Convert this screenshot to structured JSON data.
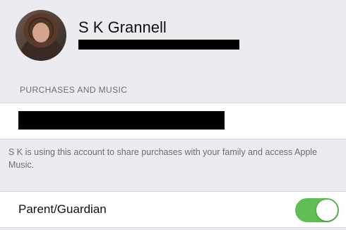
{
  "profile": {
    "name": "S K Grannell",
    "avatar": "user-avatar-photo",
    "email_redacted": true
  },
  "section": {
    "header": "PURCHASES AND MUSIC"
  },
  "account": {
    "value_redacted": true
  },
  "footer": {
    "text": "S K is using this account to share purchases with your family and access Apple Music."
  },
  "parent_guardian": {
    "label": "Parent/Guardian",
    "enabled": true,
    "switch_color": "#5fbe55"
  }
}
